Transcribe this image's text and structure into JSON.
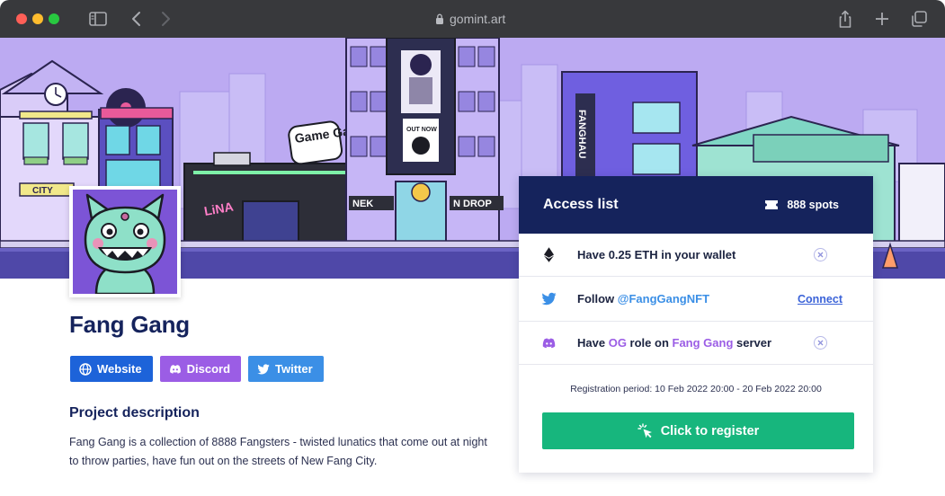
{
  "browser": {
    "url": "gomint.art",
    "icons": [
      "sidebar-icon",
      "back-icon",
      "forward-icon",
      "lock-icon",
      "share-icon",
      "new-tab-icon",
      "tabs-icon"
    ]
  },
  "banner": {
    "signs": {
      "game_gang": "Game Gang",
      "city": "CITY",
      "out_now": "OUT NOW",
      "fanghau": "FANGHAU",
      "nek": "NEK",
      "drop": "N DROP"
    }
  },
  "project": {
    "title": "Fang Gang",
    "links": {
      "website": "Website",
      "discord": "Discord",
      "twitter": "Twitter"
    },
    "description_heading": "Project description",
    "description": "Fang Gang is a collection of 8888 Fangsters - twisted lunatics that come out at night to throw parties, have fun out on the streets of New Fang City."
  },
  "access_list": {
    "title": "Access list",
    "spots": "888 spots",
    "requirements": [
      {
        "icon": "ethereum-icon",
        "text": "Have 0.25 ETH in your wallet",
        "status": "unmet"
      },
      {
        "icon": "twitter-icon",
        "prefix": "Follow ",
        "handle": "@FangGangNFT",
        "action": "Connect"
      },
      {
        "icon": "discord-icon",
        "prefix": "Have ",
        "role": "OG",
        "middle": " role on ",
        "server": "Fang Gang",
        "suffix": " server",
        "status": "unmet"
      }
    ],
    "registration_period": "Registration period: 10 Feb 2022 20:00 - 20 Feb 2022 20:00",
    "register_label": "Click to register"
  },
  "colors": {
    "navy": "#15235c",
    "website_blue": "#1d63d9",
    "discord_purple": "#9b5de5",
    "twitter_blue": "#3b8fe6",
    "register_green": "#17b67d",
    "banner_lavender": "#b9a8f0"
  }
}
